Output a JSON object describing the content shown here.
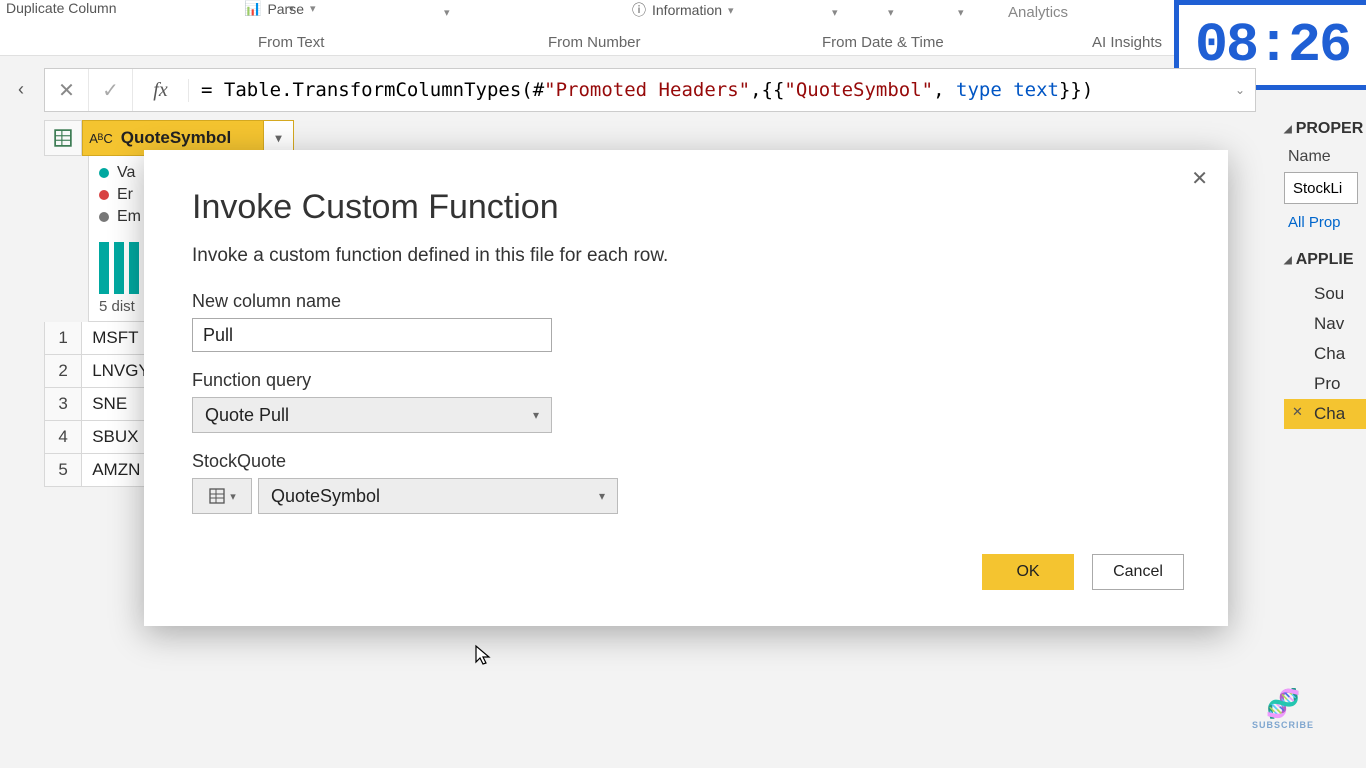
{
  "ribbon": {
    "duplicate_column": "Duplicate Column",
    "parse": "Parse",
    "information": "Information",
    "analytics": "Analytics",
    "from_text": "From Text",
    "from_number": "From Number",
    "from_date_time": "From Date & Time",
    "ai_insights": "AI Insights"
  },
  "clock": "08:26",
  "formula": {
    "prefix": "= Table.TransformColumnTypes(#",
    "arg1": "\"Promoted Headers\"",
    "mid": ",{{",
    "arg2": "\"QuoteSymbol\"",
    "mid2": ", ",
    "kw": "type ",
    "type": "text",
    "suffix": "}})"
  },
  "column": {
    "type_glyph": "AᴮC",
    "name": "QuoteSymbol"
  },
  "profile": {
    "valid": "Va",
    "error": "Er",
    "empty": "Em",
    "distinct": "5 dist"
  },
  "rows": [
    "MSFT",
    "LNVGY",
    "SNE",
    "SBUX",
    "AMZN"
  ],
  "dialog": {
    "title": "Invoke Custom Function",
    "subtitle": "Invoke a custom function defined in this file for each row.",
    "new_column_label": "New column name",
    "new_column_value": "Pull",
    "function_query_label": "Function query",
    "function_query_value": "Quote Pull",
    "param_label": "StockQuote",
    "param_value": "QuoteSymbol",
    "ok": "OK",
    "cancel": "Cancel"
  },
  "right": {
    "properties": "PROPER",
    "name_label": "Name",
    "name_value": "StockLi",
    "all_props": "All Prop",
    "applied": "APPLIE",
    "steps": [
      "Sou",
      "Nav",
      "Cha",
      "Pro",
      "Cha"
    ]
  },
  "watermark": "SUBSCRIBE"
}
